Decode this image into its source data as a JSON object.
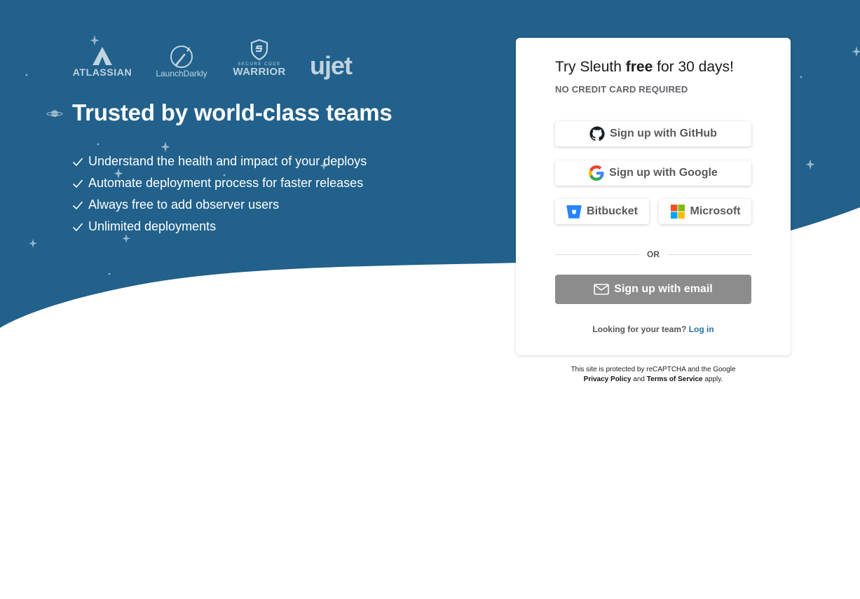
{
  "colors": {
    "hero_bg": "#21618b",
    "card_bg": "#ffffff",
    "email_button_bg": "#8c8c8c",
    "link": "#2573a7"
  },
  "logos": [
    {
      "name": "ATLASSIAN",
      "icon": "atlassian-logo"
    },
    {
      "name": "LaunchDarkly",
      "icon": "launchdarkly-rocket-logo"
    },
    {
      "name_top": "SECURE CODE",
      "name": "WARRIOR",
      "icon": "securecodewarrior-shield-logo"
    },
    {
      "name": "ujet",
      "icon": "ujet-logo"
    }
  ],
  "hero": {
    "headline": "Trusted by world-class teams",
    "features": [
      "Understand the health and impact of your deploys",
      "Automate deployment process for faster releases",
      "Always free to add observer users",
      "Unlimited deployments"
    ]
  },
  "signup": {
    "title_pre": "Try Sleuth ",
    "title_bold": "free",
    "title_post": " for 30 days!",
    "subtitle": "NO CREDIT CARD REQUIRED",
    "github_label": "Sign up with GitHub",
    "google_label": "Sign up with Google",
    "bitbucket_label": "Bitbucket",
    "microsoft_label": "Microsoft",
    "divider_label": "OR",
    "email_label": "Sign up with email",
    "team_prompt": "Looking for your team?",
    "login_label": "Log in"
  },
  "recaptcha": {
    "line1": "This site is protected by reCAPTCHA and the Google",
    "privacy_label": "Privacy Policy",
    "and_text": "and",
    "terms_label": "Terms of Service",
    "apply_text": "apply."
  }
}
